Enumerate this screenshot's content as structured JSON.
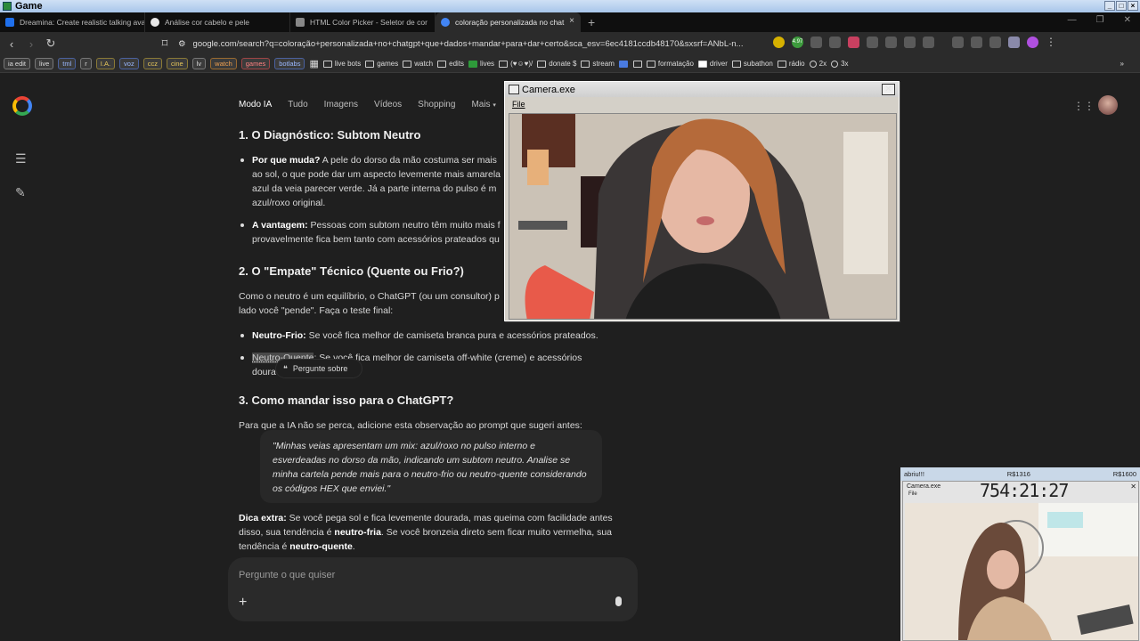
{
  "os": {
    "title": "Game"
  },
  "tabs": [
    {
      "label": "Dreamina: Create realistic talking ava",
      "color": "#1f6feb"
    },
    {
      "label": "Análise cor cabelo e pele",
      "color": "#e8e8e8"
    },
    {
      "label": "HTML Color Picker - Seletor de cor",
      "color": "#888888"
    },
    {
      "label": "coloração personalizada no chat",
      "color": "#4285f4"
    }
  ],
  "address": {
    "url": "google.com/search?q=coloração+personalizada+no+chatgpt+que+dados+mandar+para+dar+certo&sca_esv=6ec4181ccdb48170&sxsrf=ANbL-n...",
    "badge": "4.97"
  },
  "bookmarks": {
    "chips": [
      {
        "label": "ia edit",
        "tone": ""
      },
      {
        "label": "live",
        "tone": ""
      },
      {
        "label": "tml",
        "tone": "b"
      },
      {
        "label": "r",
        "tone": ""
      },
      {
        "label": "I.A.",
        "tone": "y"
      },
      {
        "label": "voz",
        "tone": "b"
      },
      {
        "label": "ccz",
        "tone": "y"
      },
      {
        "label": "cine",
        "tone": "y"
      },
      {
        "label": "lv",
        "tone": ""
      },
      {
        "label": "watch",
        "tone": "o"
      },
      {
        "label": "games",
        "tone": "r"
      },
      {
        "label": "botlabs",
        "tone": "b"
      }
    ],
    "folders": [
      "live bots",
      "games",
      "watch",
      "edits",
      "lives",
      "(♥☺♥)/",
      "donate $",
      "stream",
      "formatação",
      "driver",
      "subathon",
      "rádio",
      "2x",
      "3x"
    ]
  },
  "google_nav": [
    "Modo IA",
    "Tudo",
    "Imagens",
    "Vídeos",
    "Shopping",
    "Mais"
  ],
  "article": {
    "h1": "1. O Diagnóstico: Subtom Neutro",
    "b1_label": "Por que muda?",
    "b1_text": " A pele do dorso da mão costuma ser mais ao sol, o que pode dar um aspecto levemente mais amarela azul da veia parecer verde. Já a parte interna do pulso é m azul/roxo original.",
    "b2_label": "A vantagem:",
    "b2_text": " Pessoas com subtom neutro têm muito mais f provavelmente fica bem tanto com acessórios prateados qu",
    "h2": "2. O \"Empate\" Técnico (Quente ou Frio?)",
    "p2": "Como o neutro é um equilíbrio, o ChatGPT (ou um consultor) p lado você \"pende\". Faça o teste final:",
    "b3_label": "Neutro-Frio:",
    "b3_text": " Se você fica melhor de camiseta branca pura e acessórios prateados.",
    "b4_label": "Neutro-Quente",
    "b4_text": ": Se você fica melhor de camiseta off-white (creme) e acessórios doura",
    "ask": "Pergunte sobre",
    "h3": "3. Como mandar isso para o ChatGPT?",
    "p3": "Para que a IA não se perca, adicione esta observação ao prompt que sugeri antes:",
    "quote": "\"Minhas veias apresentam um mix: azul/roxo no pulso interno e esverdeadas no dorso da mão, indicando um subtom neutro. Analise se minha cartela pende mais para o neutro-frio ou neutro-quente considerando os códigos HEX que enviei.\"",
    "extra_label": "Dica extra:",
    "extra_1": " Se você pega sol e fica levemente dourada, mas queima com facilidade antes disso, sua tendência é ",
    "extra_b1": "neutro-fria",
    "extra_2": ". Se você bronzeia direto sem ficar muito vermelha, sua tendência é ",
    "extra_b2": "neutro-quente",
    "extra_3": "."
  },
  "prompt": {
    "placeholder": "Pergunte o que quiser"
  },
  "camera": {
    "title": "Camera.exe",
    "menu": "File"
  },
  "stream": {
    "left": "abriu!!!",
    "mid": "R$1316",
    "right": "R$1600",
    "title": "Camera.exe",
    "menu": "File",
    "timer": "754:21:27"
  }
}
